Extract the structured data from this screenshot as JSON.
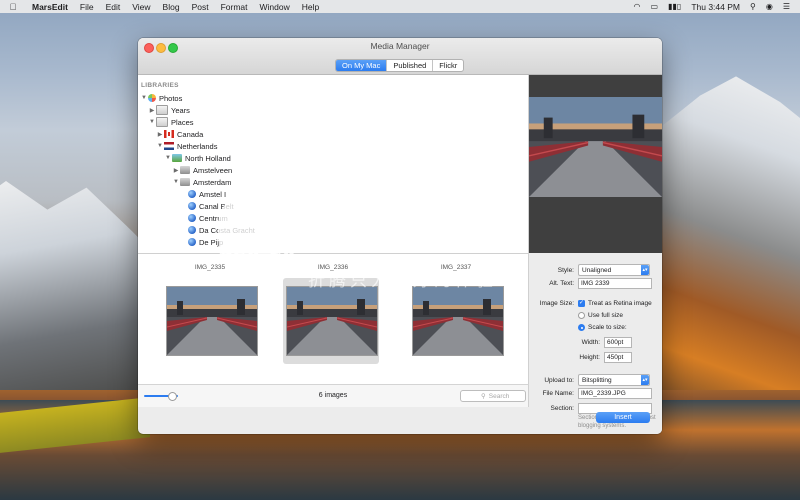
{
  "menubar": {
    "app_name": "MarsEdit",
    "items": [
      "File",
      "Edit",
      "View",
      "Blog",
      "Post",
      "Format",
      "Window",
      "Help"
    ],
    "clock": "Thu 3:44 PM"
  },
  "window": {
    "title": "Media Manager",
    "tabs": [
      {
        "label": "On My Mac",
        "active": true
      },
      {
        "label": "Published",
        "active": false
      },
      {
        "label": "Flickr",
        "active": false
      }
    ]
  },
  "sidebar": {
    "heading": "LIBRARIES",
    "tree": [
      {
        "label": "Photos",
        "icon": "photos-icon",
        "disclosure": "open"
      },
      {
        "label": "Years",
        "icon": "folder-icon",
        "disclosure": "closed"
      },
      {
        "label": "Places",
        "icon": "folder-icon",
        "disclosure": "open"
      },
      {
        "label": "Canada",
        "icon": "flag-canada-icon",
        "disclosure": "closed"
      },
      {
        "label": "Netherlands",
        "icon": "flag-netherlands-icon",
        "disclosure": "open"
      },
      {
        "label": "North Holland",
        "icon": "map-icon",
        "disclosure": "open"
      },
      {
        "label": "Amstelveen",
        "icon": "building-icon",
        "disclosure": "closed"
      },
      {
        "label": "Amsterdam",
        "icon": "building-icon",
        "disclosure": "open"
      },
      {
        "label": "Amstel I",
        "icon": "globe-icon",
        "disclosure": "none"
      },
      {
        "label": "Canal Belt",
        "icon": "globe-icon",
        "disclosure": "none"
      },
      {
        "label": "Centrum",
        "icon": "globe-icon",
        "disclosure": "none"
      },
      {
        "label": "Da Costa Gracht",
        "icon": "globe-icon",
        "disclosure": "none"
      },
      {
        "label": "De Pijp",
        "icon": "globe-icon",
        "disclosure": "none"
      }
    ]
  },
  "thumbnails": [
    {
      "label": "IMG_2335",
      "selected": false
    },
    {
      "label": "IMG_2336",
      "selected": true
    },
    {
      "label": "IMG_2337",
      "selected": false
    }
  ],
  "bottom_bar": {
    "zoom_level": 0.8,
    "count_label": "6 images",
    "search_placeholder": "Search"
  },
  "settings": {
    "style_label": "Style:",
    "style_value": "Unaligned",
    "alt_text_label": "Alt. Text:",
    "alt_text_value": "IMG 2339",
    "image_size_label": "Image Size:",
    "retina_label": "Treat as Retina image",
    "retina_checked": true,
    "full_size_label": "Use full size",
    "scale_label": "Scale to size:",
    "width_label": "Width:",
    "width_value": "600pt",
    "height_label": "Height:",
    "height_value": "450pt",
    "upload_label": "Upload to:",
    "upload_value": "Bitsplitting",
    "filename_label": "File Name:",
    "filename_value": "IMG_2339.JPG",
    "section_label": "Section:",
    "section_value": "",
    "section_note": "Section is not used with most blogging systems.",
    "insert_label": "Insert"
  },
  "watermark": {
    "site": "osx.cx",
    "title": "黑苹果社区",
    "subtitle": "折腾只为更好的体验"
  },
  "colors": {
    "accent": "#2c7cf0",
    "close": "#fc605c",
    "minimize": "#fdbc40",
    "maximize": "#34c84a"
  }
}
